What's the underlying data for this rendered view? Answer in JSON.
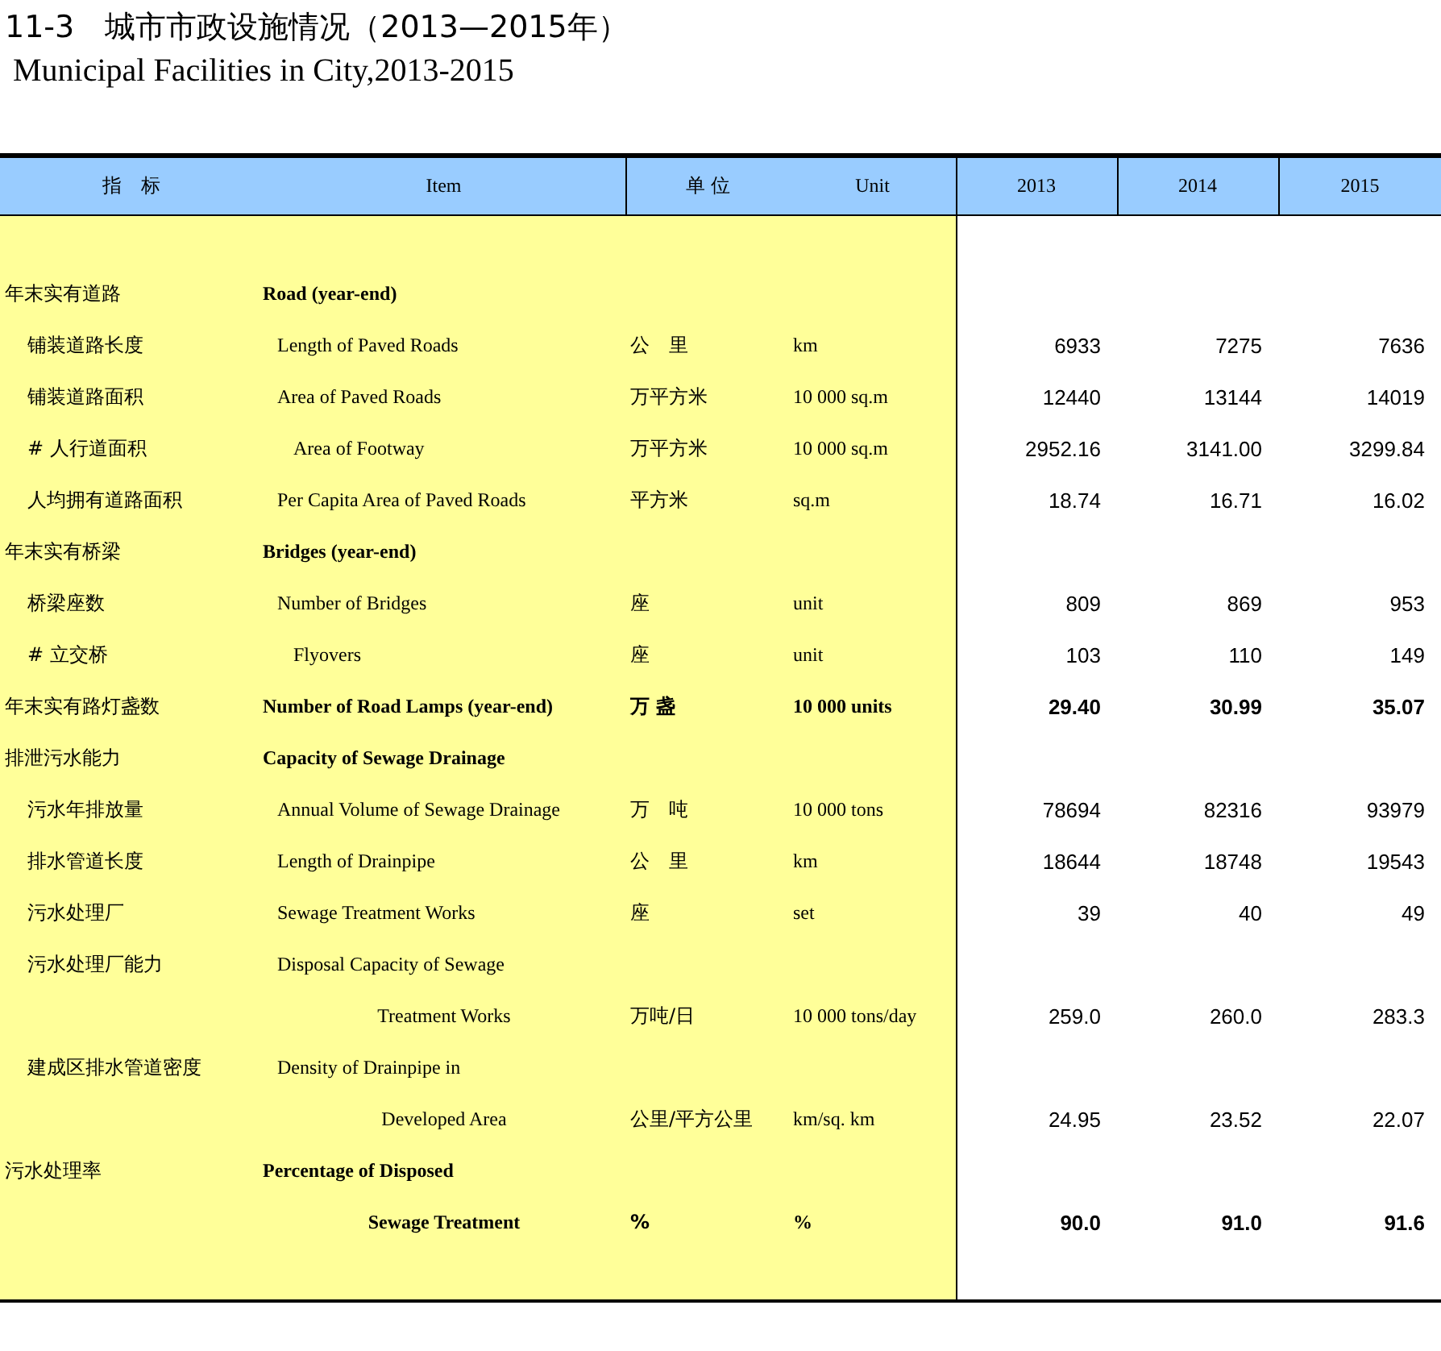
{
  "title": "11-3　城市市政设施情况（2013—2015年）",
  "subtitle": "Municipal Facilities in City,2013-2015",
  "table": {
    "header": {
      "indicator_zh": "指　标",
      "item_en": "Item",
      "unit_zh": "单 位",
      "unit_en": "Unit",
      "years": [
        "2013",
        "2014",
        "2015"
      ]
    },
    "rows": [
      {
        "kind": "category",
        "bold": true,
        "zh": "年末实有道路",
        "en": "Road (year-end)"
      },
      {
        "kind": "item",
        "bold": false,
        "zh": "铺装道路长度",
        "en": "Length of Paved Roads",
        "unit_zh": "公　里",
        "unit_en": "km",
        "values": [
          "6933",
          "7275",
          "7636"
        ]
      },
      {
        "kind": "item",
        "bold": false,
        "zh": "铺装道路面积",
        "en": "Area of Paved Roads",
        "unit_zh": "万平方米",
        "unit_en": "10 000 sq.m",
        "values": [
          "12440",
          "13144",
          "14019"
        ]
      },
      {
        "kind": "subitem",
        "bold": false,
        "zh": "#  人行道面积",
        "en": "Area of Footway",
        "unit_zh": "万平方米",
        "unit_en": "10 000 sq.m",
        "values": [
          "2952.16",
          "3141.00",
          "3299.84"
        ]
      },
      {
        "kind": "item",
        "bold": false,
        "zh": "人均拥有道路面积",
        "en": "Per Capita Area of Paved Roads",
        "unit_zh": "平方米",
        "unit_en": "sq.m",
        "values": [
          "18.74",
          "16.71",
          "16.02"
        ]
      },
      {
        "kind": "category",
        "bold": true,
        "zh": "年末实有桥梁",
        "en": "Bridges (year-end)"
      },
      {
        "kind": "item",
        "bold": false,
        "zh": "桥梁座数",
        "en": "Number of Bridges",
        "unit_zh": "座",
        "unit_en": "unit",
        "values": [
          "809",
          "869",
          "953"
        ]
      },
      {
        "kind": "subitem",
        "bold": false,
        "zh": "#  立交桥",
        "en": "Flyovers",
        "unit_zh": "座",
        "unit_en": "unit",
        "values": [
          "103",
          "110",
          "149"
        ]
      },
      {
        "kind": "category",
        "bold": true,
        "zh": "年末实有路灯盏数",
        "en": "Number of Road Lamps (year-end)",
        "unit_zh": "万 盏",
        "unit_en": "10 000 units",
        "values": [
          "29.40",
          "30.99",
          "35.07"
        ]
      },
      {
        "kind": "category",
        "bold": true,
        "zh": "排泄污水能力",
        "en": "Capacity of Sewage Drainage"
      },
      {
        "kind": "item",
        "bold": false,
        "zh": "污水年排放量",
        "en": "Annual Volume of Sewage Drainage",
        "unit_zh": "万　吨",
        "unit_en": "10 000 tons",
        "values": [
          "78694",
          "82316",
          "93979"
        ]
      },
      {
        "kind": "item",
        "bold": false,
        "zh": "排水管道长度",
        "en": "Length of Drainpipe",
        "unit_zh": "公　里",
        "unit_en": "km",
        "values": [
          "18644",
          "18748",
          "19543"
        ]
      },
      {
        "kind": "item",
        "bold": false,
        "zh": "污水处理厂",
        "en": "Sewage Treatment Works",
        "unit_zh": "座",
        "unit_en": "set",
        "values": [
          "39",
          "40",
          "49"
        ]
      },
      {
        "kind": "item",
        "bold": false,
        "zh": "污水处理厂能力",
        "en": "Disposal Capacity of Sewage"
      },
      {
        "kind": "continuation",
        "bold": false,
        "en": "Treatment Works",
        "unit_zh": "万吨/日",
        "unit_en": "10 000 tons/day",
        "values": [
          "259.0",
          "260.0",
          "283.3"
        ]
      },
      {
        "kind": "item",
        "bold": false,
        "zh": "建成区排水管道密度",
        "en": "Density of Drainpipe in"
      },
      {
        "kind": "continuation",
        "bold": false,
        "en": "Developed Area",
        "unit_zh": "公里/平方公里",
        "unit_en": "km/sq. km",
        "values": [
          "24.95",
          "23.52",
          "22.07"
        ]
      },
      {
        "kind": "category",
        "bold": true,
        "zh": "污水处理率",
        "en": "Percentage of Disposed"
      },
      {
        "kind": "continuation",
        "bold": true,
        "en": "Sewage Treatment",
        "unit_zh": "%",
        "unit_en": "%",
        "values": [
          "90.0",
          "91.0",
          "91.6"
        ]
      }
    ]
  }
}
